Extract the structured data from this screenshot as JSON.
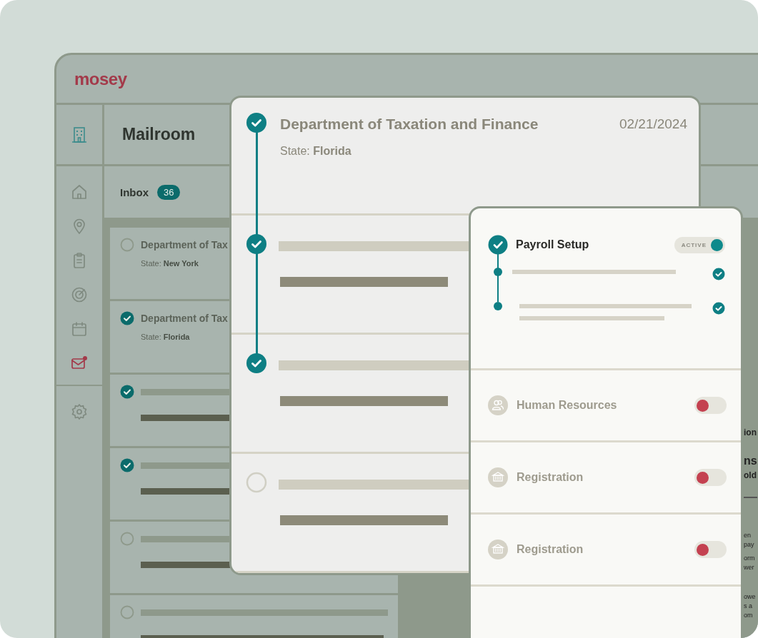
{
  "app": {
    "logo": "mosey"
  },
  "sidebar": {
    "items": [
      {
        "selected": false,
        "notification": false
      },
      {
        "selected": false,
        "notification": false
      },
      {
        "selected": false,
        "notification": false
      },
      {
        "selected": false,
        "notification": false
      },
      {
        "selected": false,
        "notification": false
      },
      {
        "selected": true,
        "notification": true
      },
      {
        "selected": false,
        "notification": false
      }
    ]
  },
  "page_title": "Mailroom",
  "inbox": {
    "label": "Inbox",
    "count": "36"
  },
  "mail_list": [
    {
      "checked": false,
      "title": "Department of Tax",
      "subtitle": "State: **New York**"
    },
    {
      "checked": true,
      "title": "Department of Tax",
      "subtitle": "State: **Florida**"
    },
    {
      "checked": true
    },
    {
      "checked": true
    },
    {
      "checked": false
    },
    {
      "checked": false
    }
  ],
  "letter_card": {
    "checked": true,
    "title": "Department of Taxation and Finance",
    "date": "02/21/2024",
    "subtitle": "State: **Florida**",
    "steps": [
      {
        "checked": true
      },
      {
        "checked": true
      },
      {
        "checked": false
      }
    ]
  },
  "setup_card": {
    "sections": [
      {
        "kind": "payroll",
        "title": "Payroll Setup",
        "on": true,
        "disabled": false,
        "toggle_label": "ACTIVE",
        "tasks": [
          {
            "checked": true,
            "kind": "single"
          },
          {
            "checked": true,
            "kind": "double"
          }
        ]
      },
      {
        "kind": "people",
        "title": "Human Resources",
        "on": false,
        "disabled": true
      },
      {
        "kind": "bank",
        "title": "Registration",
        "on": false,
        "disabled": true
      },
      {
        "kind": "bank",
        "title": "Registration",
        "on": false,
        "disabled": true
      }
    ]
  },
  "document_fragments": [
    {
      "kind": "label",
      "text": "ion"
    },
    {
      "kind": "heading",
      "text": "ns"
    },
    {
      "kind": "label",
      "text": "old"
    },
    {
      "kind": "rule"
    },
    {
      "kind": "body",
      "text": "en"
    },
    {
      "kind": "body",
      "text": "pay"
    },
    {
      "kind": "gap"
    },
    {
      "kind": "body",
      "text": "orm"
    },
    {
      "kind": "body",
      "text": "wer"
    },
    {
      "kind": "gap2"
    },
    {
      "kind": "body",
      "text": "owe"
    },
    {
      "kind": "body",
      "text": "s a"
    },
    {
      "kind": "body",
      "text": "om"
    }
  ]
}
